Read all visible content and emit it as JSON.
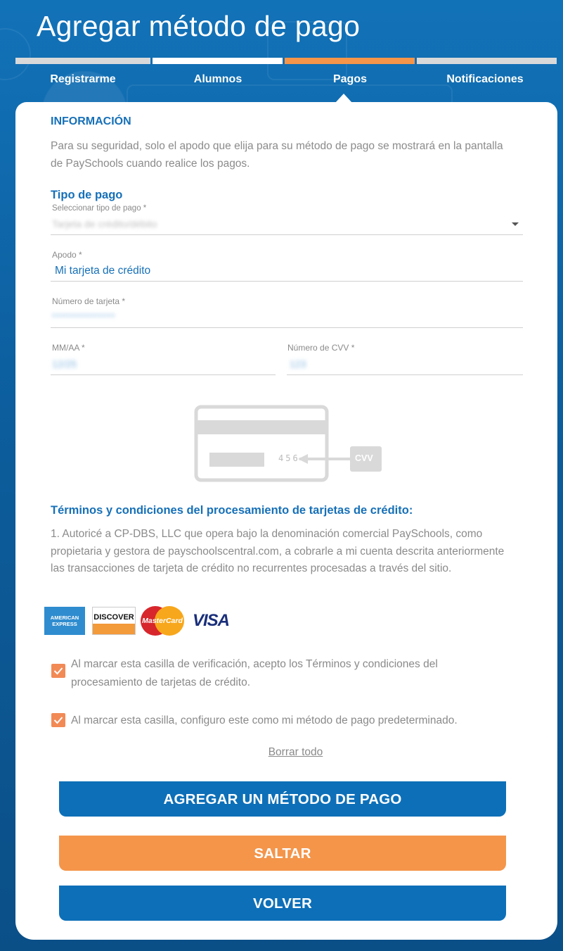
{
  "header": {
    "title": "Agregar método de pago",
    "steps": [
      {
        "label": "Registrarme",
        "bar_color": "#d9d9d9"
      },
      {
        "label": "Alumnos",
        "bar_color": "#ffffff"
      },
      {
        "label": "Pagos",
        "bar_color": "#f4954a"
      },
      {
        "label": "Notificaciones",
        "bar_color": "#d9d9d9"
      }
    ],
    "active_step": "Pagos"
  },
  "info": {
    "title": "INFORMACIÓN",
    "text": "Para su seguridad, solo el apodo que elija para su método de pago se mostrará en la pantalla de PaySchools cuando realice los pagos."
  },
  "payment_type": {
    "title": "Tipo de pago",
    "select_label": "Seleccionar tipo de pago *",
    "select_value": "Tarjeta de crédito/débito"
  },
  "fields": {
    "nickname_label": "Apodo *",
    "nickname_value": "Mi tarjeta de crédito",
    "card_number_label": "Número de tarjeta *",
    "card_number_value": "**************",
    "expiry_label": "MM/AA *",
    "expiry_value": "12/25",
    "cvv_label": "Número de CVV *",
    "cvv_value": "123"
  },
  "card_illustration": {
    "digits": "456",
    "cvv_tag": "CVV"
  },
  "terms": {
    "title": "Términos y condiciones del procesamiento de tarjetas de crédito:",
    "text": "1. Autoricé a CP-DBS, LLC que opera bajo la denominación comercial PaySchools, como propietaria y gestora de payschoolscentral.com, a cobrarle a mi cuenta descrita anteriormente las transacciones de tarjeta de crédito no recurrentes procesadas a través del sitio."
  },
  "card_logos": {
    "amex": "AMERICAN EXPRESS",
    "discover": "DISCOVER",
    "mastercard": "MasterCard",
    "visa": "VISA"
  },
  "checkboxes": {
    "accept_terms": "Al marcar esta casilla de verificación, acepto los Términos y condiciones del procesamiento de tarjetas de crédito.",
    "set_default": "Al marcar esta casilla, configuro este como mi método de pago predeterminado."
  },
  "actions": {
    "clear_all": "Borrar todo",
    "add": "AGREGAR UN MÉTODO DE PAGO",
    "skip": "SALTAR",
    "back": "VOLVER"
  },
  "colors": {
    "primary": "#0d6fb8",
    "accent": "#f4954a",
    "text_muted": "#8a8a8a"
  }
}
